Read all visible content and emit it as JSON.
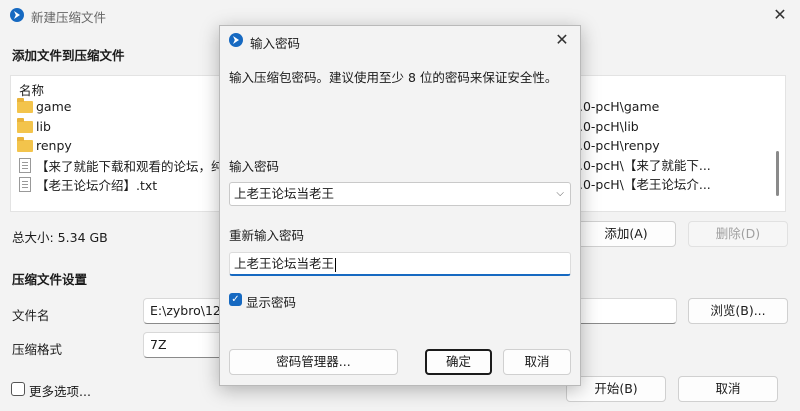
{
  "main": {
    "title": "新建压缩文件",
    "add_section": "添加文件到压缩文件",
    "column_name": "名称",
    "files": [
      {
        "name": "game",
        "type": "folder"
      },
      {
        "name": "lib",
        "type": "folder"
      },
      {
        "name": "renpy",
        "type": "folder"
      },
      {
        "name": "【来了就能下载和观看的论坛，纯",
        "type": "file"
      },
      {
        "name": "【老王论坛介绍】.txt",
        "type": "file"
      }
    ],
    "paths": [
      ".0-pcH\\game",
      ".0-pcH\\lib",
      ".0-pcH\\renpy",
      ".0-pcH\\【来了就能下...",
      ".0-pcH\\【老王论坛介..."
    ],
    "total_size": "总大小: 5.34 GB",
    "add_button": "添加(A)",
    "delete_button": "删除(D)",
    "settings_section": "压缩文件设置",
    "filename_label": "文件名",
    "filename_value": "E:\\zybro\\12f",
    "browse_button": "浏览(B)...",
    "format_label": "压缩格式",
    "format_value": "7Z",
    "more_options": "更多选项...",
    "start_button": "开始(B)",
    "cancel_button": "取消"
  },
  "dialog": {
    "title": "输入密码",
    "description": "输入压缩包密码。建议使用至少 8 位的密码来保证安全性。",
    "password_label": "输入密码",
    "password_value": "上老王论坛当老王",
    "reenter_label": "重新输入密码",
    "reenter_value": "上老王论坛当老王",
    "show_password": "显示密码",
    "manager_button": "密码管理器...",
    "ok_button": "确定",
    "cancel_button": "取消"
  },
  "colors": {
    "accent": "#1669c1",
    "folder": "#f3c44c"
  }
}
